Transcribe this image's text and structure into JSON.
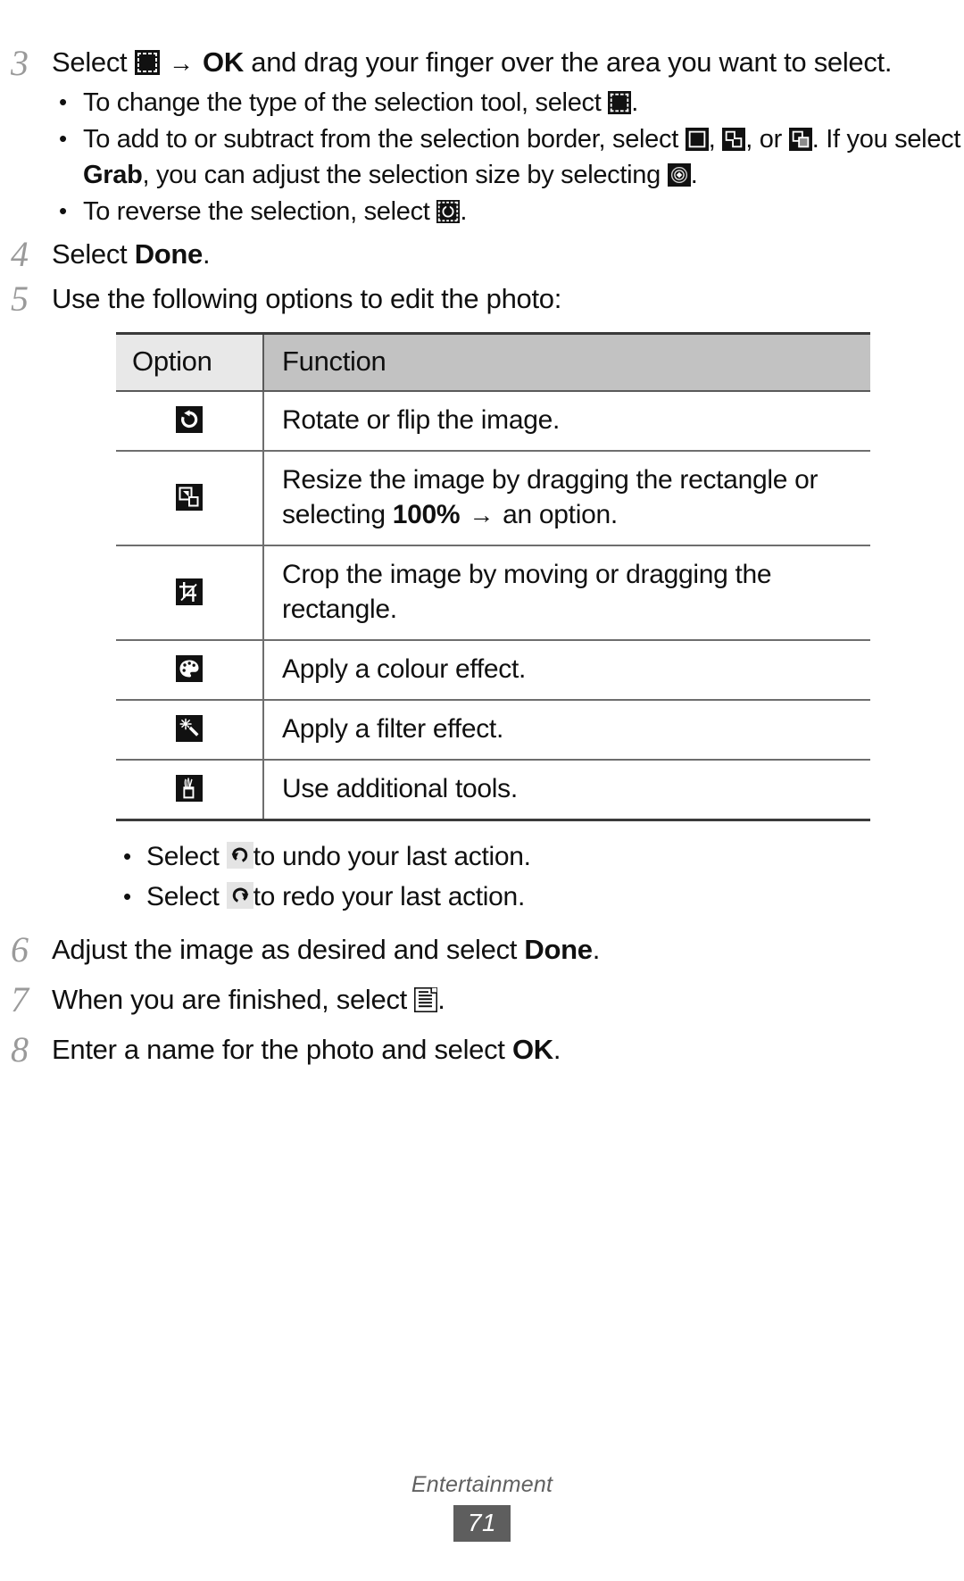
{
  "document": {
    "footer_title": "Entertainment",
    "page_number": "71"
  },
  "steps": [
    {
      "number": "3",
      "text_before_icon": "Select",
      "icon": "selection-tool-icon",
      "arrow": "→",
      "bold_label": "OK",
      "text_after": "and drag your finger over the area you want to select.",
      "bullets": [
        {
          "id": "change-selection-tool",
          "text_before": "To change the type of the selection tool, select",
          "icons": [
            "selection-tool-icon"
          ],
          "text_after": "."
        },
        {
          "id": "add-subtract-selection",
          "text_before": "To add to or subtract from the selection border, select",
          "icons": [
            "square-select-icon",
            "add-selection-icon",
            "subtract-selection-icon"
          ],
          "separator_1": ",",
          "separator_2": ", or",
          "text_mid": ". If you select",
          "bold_label": "Grab",
          "text_mid2": ", you can adjust the selection size by selecting",
          "icons_tail": [
            "grab-size-icon"
          ],
          "text_after": "."
        },
        {
          "id": "reverse-selection",
          "text_before": "To reverse the selection, select",
          "icons": [
            "reverse-selection-icon"
          ],
          "text_after": "."
        }
      ]
    },
    {
      "number": "4",
      "text_before_bold": "Select",
      "bold_label": "Done",
      "text_after": "."
    },
    {
      "number": "5",
      "text": "Use the following options to edit the photo:"
    },
    {
      "number": "6",
      "text_before_bold": "Adjust the image as desired and select",
      "bold_label": "Done",
      "text_after": "."
    },
    {
      "number": "7",
      "text_before_icon": "When you are finished, select",
      "icon": "save-icon",
      "text_after": "."
    },
    {
      "number": "8",
      "text_before_bold": "Enter a name for the photo and select",
      "bold_label": "OK",
      "text_after": "."
    }
  ],
  "table": {
    "headers": {
      "option": "Option",
      "function": "Function"
    },
    "rows": [
      {
        "icon": "rotate-icon",
        "function_text": "Rotate or flip the image."
      },
      {
        "icon": "resize-icon",
        "function_text_1": "Resize the image by dragging the rectangle or selecting",
        "bold_label": "100%",
        "arrow": "→",
        "function_text_2": "an option."
      },
      {
        "icon": "crop-icon",
        "function_text": "Crop the image by moving or dragging the rectangle."
      },
      {
        "icon": "colour-effect-icon",
        "function_text": "Apply a colour effect."
      },
      {
        "icon": "filter-effect-icon",
        "function_text": "Apply a filter effect."
      },
      {
        "icon": "additional-tools-icon",
        "function_text": "Use additional tools."
      }
    ]
  },
  "after_table_bullets": [
    {
      "id": "undo",
      "text_before": "Select",
      "icon": "undo-icon",
      "text_after": "to undo your last action."
    },
    {
      "id": "redo",
      "text_before": "Select",
      "icon": "redo-icon",
      "text_after": "to redo your last action."
    }
  ],
  "colors": {
    "header_option_bg": "#e8e8e8",
    "header_function_bg": "#c2c2c2",
    "step_number": "#9a9a9a",
    "page_badge_bg": "#5e5e5e",
    "footer_text": "#606060",
    "icon_fill": "#111111"
  }
}
